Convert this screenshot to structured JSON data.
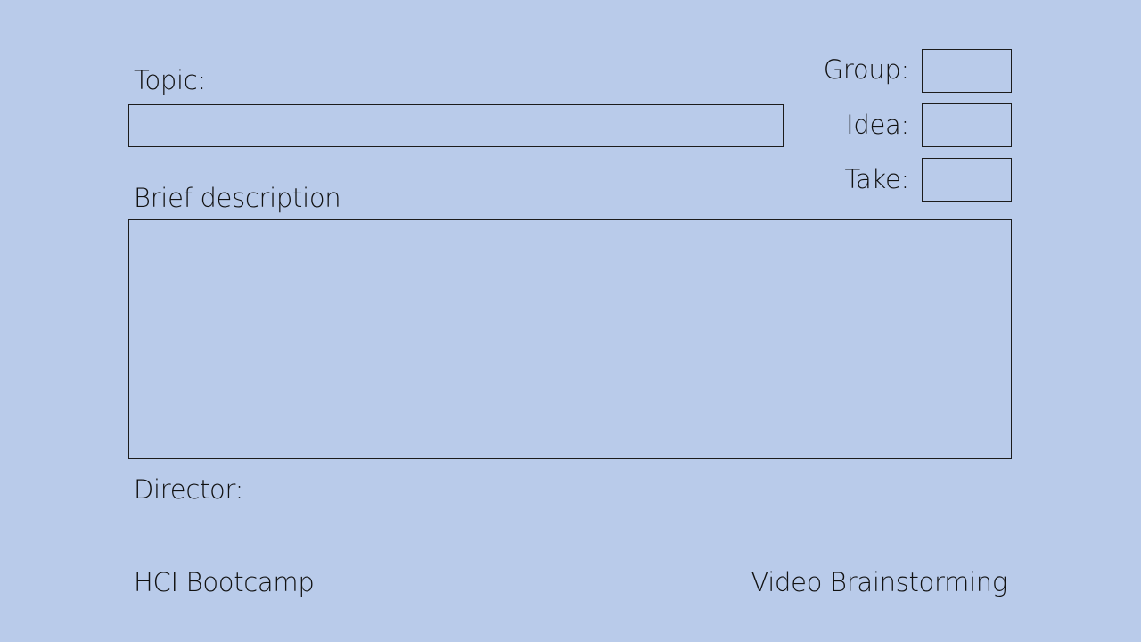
{
  "form": {
    "topic_label": "Topic:",
    "topic_value": "",
    "description_label": "Brief description",
    "description_value": "",
    "director_label": "Director:",
    "group_label": "Group:",
    "group_value": "",
    "idea_label": "Idea:",
    "idea_value": "",
    "take_label": "Take:",
    "take_value": ""
  },
  "footer": {
    "left": "HCI Bootcamp",
    "right": "Video Brainstorming"
  },
  "colors": {
    "background": "#b9cbea",
    "border": "#1c1c1c"
  }
}
